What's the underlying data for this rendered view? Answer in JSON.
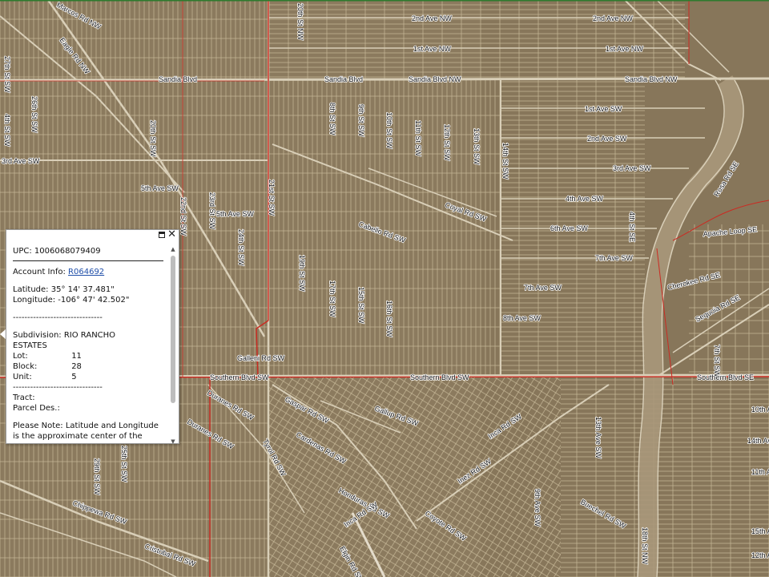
{
  "map": {
    "streets": [
      {
        "id": "marcos-rd",
        "text": "Marcos Rd NW"
      },
      {
        "id": "eagle-rd",
        "text": "Eagle Rd NW"
      },
      {
        "id": "2nd-ave-nw-a",
        "text": "2nd Ave NW"
      },
      {
        "id": "2nd-ave-nw-b",
        "text": "2nd Ave NW"
      },
      {
        "id": "1st-ave-nw-a",
        "text": "1st Ave NW"
      },
      {
        "id": "1st-ave-nw-b",
        "text": "1st Ave NW"
      },
      {
        "id": "sandia-blvd-a",
        "text": "Sandia Blvd"
      },
      {
        "id": "sandia-blvd-b",
        "text": "Sandia Blvd"
      },
      {
        "id": "sandia-blvd-c",
        "text": "Sandia Blvd NW"
      },
      {
        "id": "sandia-blvd-d",
        "text": "Sandia Blvd NW"
      },
      {
        "id": "1st-ave-sw",
        "text": "1st Ave SW"
      },
      {
        "id": "2nd-ave-sw",
        "text": "2nd Ave SW"
      },
      {
        "id": "3rd-ave-sw-w",
        "text": "3rd Ave SW"
      },
      {
        "id": "3rd-ave-sw-e",
        "text": "3rd Ave SW"
      },
      {
        "id": "4th-ave-sw",
        "text": "4th Ave SW"
      },
      {
        "id": "5th-ave-sw-w",
        "text": "5th Ave SW"
      },
      {
        "id": "5th-ave-sw-e",
        "text": "5th Ave SW"
      },
      {
        "id": "6th-ave-sw",
        "text": "6th Ave SW"
      },
      {
        "id": "7th-ave-sw-w",
        "text": "7th Ave SW"
      },
      {
        "id": "7th-ave-sw-e",
        "text": "7th Ave SW"
      },
      {
        "id": "8th-ave-sw",
        "text": "8th Ave SW"
      },
      {
        "id": "coyal-rd",
        "text": "Coyal Rd SW"
      },
      {
        "id": "cabello-rd",
        "text": "Cabello Rd SW"
      },
      {
        "id": "galleni-rd",
        "text": "Galleni Rd SW"
      },
      {
        "id": "southern-blvd-a",
        "text": "Southern Blvd SW"
      },
      {
        "id": "southern-blvd-b",
        "text": "Southern Blvd SW"
      },
      {
        "id": "southern-blvd-c",
        "text": "Southern Blvd SE"
      },
      {
        "id": "gallup-rd",
        "text": "Gallup Rd SW"
      },
      {
        "id": "gaspar-rd",
        "text": "Gaspar Rd SW"
      },
      {
        "id": "duranes-rd-a",
        "text": "Duranes Rd SW"
      },
      {
        "id": "duranes-rd-b",
        "text": "Duranes Rd SW"
      },
      {
        "id": "cardenas-rd",
        "text": "Cardenas Rd SW"
      },
      {
        "id": "tyrol-rd",
        "text": "Tyrol Rd SW"
      },
      {
        "id": "chippewa-rd",
        "text": "Chippewa Rd SW"
      },
      {
        "id": "cristobal-rd",
        "text": "Cristobal Rd SW"
      },
      {
        "id": "honduras-rd",
        "text": "Honduras Rd SW"
      },
      {
        "id": "inca-rd-a",
        "text": "Inca Rd SW"
      },
      {
        "id": "inca-rd-b",
        "text": "Inca Rd SW"
      },
      {
        "id": "inez-rd",
        "text": "Inez Rd SW"
      },
      {
        "id": "coyote-rd",
        "text": "Coyote Rd SW"
      },
      {
        "id": "elgin-rd",
        "text": "Elgin Rd SW"
      },
      {
        "id": "buechel-rd",
        "text": "Buechel Rd SW"
      },
      {
        "id": "apache-loop",
        "text": "Apache Loop SE"
      },
      {
        "id": "rosa-rd",
        "text": "Rosa Rd SE"
      },
      {
        "id": "cherokee-rd",
        "text": "Cherokee Rd SE"
      },
      {
        "id": "sequoia-rd",
        "text": "Sequoia Rd SE"
      },
      {
        "id": "8th-st-sw-a",
        "text": "8th St SW"
      },
      {
        "id": "9th-st-sw-a",
        "text": "9th St SW"
      },
      {
        "id": "10th-st-sw-a",
        "text": "10th St SW"
      },
      {
        "id": "11th-st-sw-a",
        "text": "11th St SW"
      },
      {
        "id": "12th-st-sw-a",
        "text": "12th St SW"
      },
      {
        "id": "13th-st-sw-a",
        "text": "13th St SW"
      },
      {
        "id": "14th-st-sw-a",
        "text": "14th St SW"
      },
      {
        "id": "15th-st-sw",
        "text": "15th St SW"
      },
      {
        "id": "16th-st-sw",
        "text": "16th St SW"
      },
      {
        "id": "17th-st-sw",
        "text": "17th St SW"
      },
      {
        "id": "19th-st-sw",
        "text": "19th St SW"
      },
      {
        "id": "20th-st-sw-a",
        "text": "20th St SW"
      },
      {
        "id": "21st-st-sw-a",
        "text": "21st St SW"
      },
      {
        "id": "22nd-st-sw-a",
        "text": "22nd St SW"
      },
      {
        "id": "23rd-st-sw",
        "text": "23rd St SW"
      },
      {
        "id": "24th-st-sw",
        "text": "24th St SW"
      },
      {
        "id": "25th-st-sw",
        "text": "25th St SW"
      },
      {
        "id": "26th-st-sw",
        "text": "26th St SW"
      },
      {
        "id": "27th-st-sw",
        "text": "27th St SW"
      },
      {
        "id": "29th-st-sw",
        "text": "29th St SW"
      },
      {
        "id": "4th-st-sw",
        "text": "4th St SW"
      },
      {
        "id": "4th-st-se",
        "text": "4th St SE"
      },
      {
        "id": "7th-st-sw",
        "text": "7th St SW"
      },
      {
        "id": "13th-ave-sw",
        "text": "13th Ave SW"
      },
      {
        "id": "14th-ave-sw",
        "text": "14th Ave SW"
      },
      {
        "id": "15th-ave-sw",
        "text": "15th Ave SW"
      },
      {
        "id": "12th-ave-sw",
        "text": "12th Ave SW"
      },
      {
        "id": "11th-ave-sw",
        "text": "11th Ave SW"
      },
      {
        "id": "10th-ave-sw",
        "text": "10th Ave SW"
      },
      {
        "id": "9th-ave-sw",
        "text": "9th Ave SW"
      },
      {
        "id": "18th-st-nw",
        "text": "18th St NW"
      },
      {
        "id": "20th-st-nw",
        "text": "20th St NW"
      }
    ]
  },
  "popup": {
    "upc_label": "UPC:",
    "upc_value": "1006068079409",
    "account_label": "Account Info:",
    "account_value": "R064692",
    "latitude_label": "Latitude:",
    "latitude_value": "35° 14' 37.481\"",
    "longitude_label": "Longitude:",
    "longitude_value": "-106° 47' 42.502\"",
    "separator": "-------------------------------",
    "subdivision_label": "Subdivision:",
    "subdivision_value": "RIO RANCHO",
    "subdivision_value2": "ESTATES",
    "lot_label": "Lot:",
    "lot_value": "11",
    "block_label": "Block:",
    "block_value": "28",
    "unit_label": "Unit:",
    "unit_value": "5",
    "tract_label": "Tract:",
    "parcel_label": "Parcel Des.:",
    "note": "Please Note: Latitude and Longitude is the approximate center of the parcel shown.",
    "close_glyph": "✕",
    "scroll_up_glyph": "▲",
    "scroll_down_glyph": "▼"
  },
  "colors": {
    "terrain": "#8b7a5e",
    "parcel_line": "#c9bca0",
    "road": "#d9cfb8",
    "boundary": "#cc2a22",
    "link": "#1f4ea8"
  }
}
